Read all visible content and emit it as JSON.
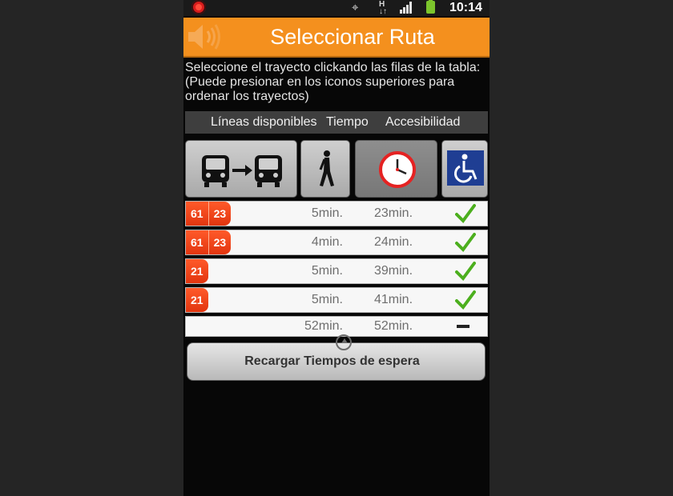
{
  "status_bar": {
    "time": "10:14",
    "network": "H"
  },
  "title_bar": {
    "title": "Seleccionar Ruta"
  },
  "instructions": {
    "line1": "Seleccione el trayecto clickando las filas de la tabla:",
    "line2": "(Puede presionar en los iconos superiores para ordenar los trayectos)"
  },
  "table_header": {
    "lines": "Líneas disponibles",
    "time": "Tiempo",
    "accessibility": "Accesibilidad"
  },
  "sort_icons": [
    "bus-transfer-icon",
    "walking-person-icon",
    "clock-icon",
    "wheelchair-icon"
  ],
  "routes": [
    {
      "lines": [
        "61",
        "23"
      ],
      "walk": "5min.",
      "total": "23min.",
      "accessible": true
    },
    {
      "lines": [
        "61",
        "23"
      ],
      "walk": "4min.",
      "total": "24min.",
      "accessible": true
    },
    {
      "lines": [
        "21"
      ],
      "walk": "5min.",
      "total": "39min.",
      "accessible": true
    },
    {
      "lines": [
        "21"
      ],
      "walk": "5min.",
      "total": "41min.",
      "accessible": true
    },
    {
      "lines": [],
      "walk": "52min.",
      "total": "52min.",
      "accessible": false
    }
  ],
  "reload_button": {
    "label": "Recargar Tiempos de espera"
  },
  "colors": {
    "title_bar": "#f4901e",
    "line_badge": "#e8401a",
    "check": "#4caf1e",
    "background": "#070707"
  }
}
